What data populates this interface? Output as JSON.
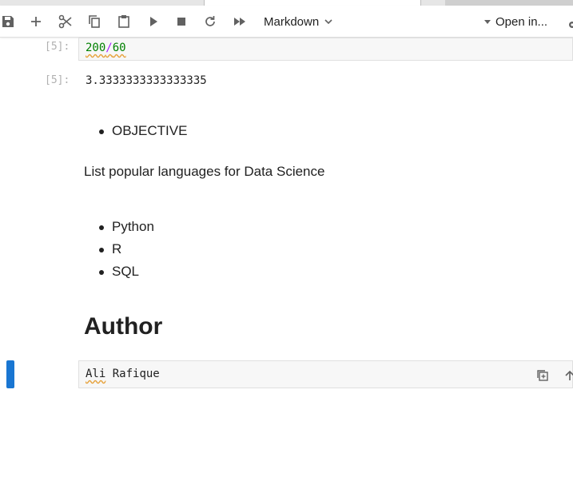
{
  "toolbar": {
    "cell_type": "Markdown",
    "open_in": "Open in..."
  },
  "cells": {
    "input_prompt": "[5]:",
    "input_code": {
      "left": "200",
      "operator": "/",
      "right": "60"
    },
    "output_prompt": "[5]:",
    "output_value": "3.3333333333333335",
    "objective_list": [
      "OBJECTIVE"
    ],
    "paragraph": "List popular languages for Data Science",
    "languages": [
      "Python",
      "R",
      "SQL"
    ],
    "heading": "Author",
    "active_cell": {
      "first": "Ali",
      "rest": " Rafique"
    }
  },
  "colors": {
    "accent": "#1976d2",
    "number": "#008000",
    "operator": "#aa22ff",
    "prompt": "#b0b0b0"
  }
}
